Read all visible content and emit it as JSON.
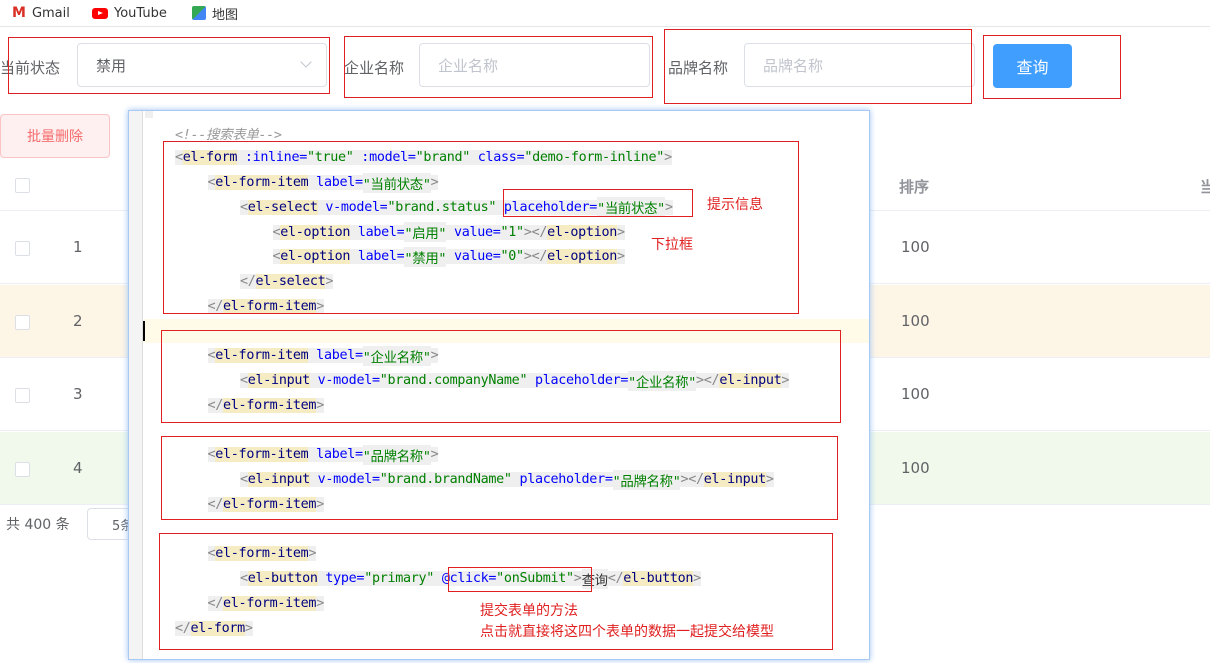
{
  "bookmarks": [
    {
      "label": "Gmail",
      "icon": "gmail-icon"
    },
    {
      "label": "YouTube",
      "icon": "youtube-icon"
    },
    {
      "label": "地图",
      "icon": "maps-icon"
    }
  ],
  "form": {
    "status_label": "当前状态",
    "status_value": "禁用",
    "company_label": "企业名称",
    "company_placeholder": "企业名称",
    "brand_label": "品牌名称",
    "brand_placeholder": "品牌名称",
    "query_button": "查询"
  },
  "batch_delete": "批量删除",
  "table": {
    "headers": {
      "sort": "排序",
      "status_partial": "当"
    },
    "rows": [
      {
        "index": "1",
        "sort": "100",
        "highlight": "none"
      },
      {
        "index": "2",
        "sort": "100",
        "highlight": "warning"
      },
      {
        "index": "3",
        "sort": "100",
        "highlight": "none"
      },
      {
        "index": "4",
        "sort": "100",
        "highlight": "success"
      }
    ]
  },
  "pagination": {
    "total": "共 400 条",
    "page_size_partial": "5条"
  },
  "colors": {
    "primary": "#409eff",
    "danger": "#f56c6c",
    "warning_row": "#fdf5e6",
    "success_row": "#f0f9eb",
    "annotation": "#e02020"
  },
  "code_lines": [
    {
      "indent": 0,
      "tokens": [
        {
          "t": "<!--搜索表单-->",
          "c": "cmt"
        }
      ]
    },
    {
      "indent": 0,
      "tokens": [
        {
          "t": "<",
          "c": "br"
        },
        {
          "t": "el-form",
          "c": "tag"
        },
        {
          "t": " :inline=",
          "c": "attr"
        },
        {
          "t": "\"true\"",
          "c": "str"
        },
        {
          "t": " :model=",
          "c": "attr"
        },
        {
          "t": "\"brand\"",
          "c": "str"
        },
        {
          "t": " class=",
          "c": "attr"
        },
        {
          "t": "\"demo-form-inline\"",
          "c": "str"
        },
        {
          "t": ">",
          "c": "br"
        }
      ]
    },
    {
      "indent": 1,
      "tokens": [
        {
          "t": "<",
          "c": "br"
        },
        {
          "t": "el-form-item",
          "c": "tag"
        },
        {
          "t": " label=",
          "c": "attr"
        },
        {
          "t": "\"当前状态\"",
          "c": "str"
        },
        {
          "t": ">",
          "c": "br"
        }
      ]
    },
    {
      "indent": 2,
      "tokens": [
        {
          "t": "<",
          "c": "br"
        },
        {
          "t": "el-select",
          "c": "tag"
        },
        {
          "t": " v-model=",
          "c": "attr"
        },
        {
          "t": "\"brand.status\"",
          "c": "str"
        },
        {
          "t": " placeholder=",
          "c": "attr"
        },
        {
          "t": "\"当前状态\"",
          "c": "str"
        },
        {
          "t": ">",
          "c": "br"
        }
      ]
    },
    {
      "indent": 3,
      "tokens": [
        {
          "t": "<",
          "c": "br"
        },
        {
          "t": "el-option",
          "c": "tag"
        },
        {
          "t": " label=",
          "c": "attr"
        },
        {
          "t": "\"启用\"",
          "c": "str"
        },
        {
          "t": " value=",
          "c": "attr"
        },
        {
          "t": "\"1\"",
          "c": "str"
        },
        {
          "t": "></",
          "c": "br"
        },
        {
          "t": "el-option",
          "c": "tagc"
        },
        {
          "t": ">",
          "c": "br"
        }
      ]
    },
    {
      "indent": 3,
      "tokens": [
        {
          "t": "<",
          "c": "br"
        },
        {
          "t": "el-option",
          "c": "tag"
        },
        {
          "t": " label=",
          "c": "attr"
        },
        {
          "t": "\"禁用\"",
          "c": "str"
        },
        {
          "t": " value=",
          "c": "attr"
        },
        {
          "t": "\"0\"",
          "c": "str"
        },
        {
          "t": "></",
          "c": "br"
        },
        {
          "t": "el-option",
          "c": "tagc"
        },
        {
          "t": ">",
          "c": "br"
        }
      ]
    },
    {
      "indent": 2,
      "tokens": [
        {
          "t": "</",
          "c": "br"
        },
        {
          "t": "el-select",
          "c": "tagc"
        },
        {
          "t": ">",
          "c": "br"
        }
      ]
    },
    {
      "indent": 1,
      "tokens": [
        {
          "t": "</",
          "c": "br"
        },
        {
          "t": "el-form-item",
          "c": "tagc"
        },
        {
          "t": ">",
          "c": "br"
        }
      ]
    },
    {
      "indent": 0,
      "tokens": []
    },
    {
      "indent": 1,
      "tokens": [
        {
          "t": "<",
          "c": "br"
        },
        {
          "t": "el-form-item",
          "c": "tag"
        },
        {
          "t": " label=",
          "c": "attr"
        },
        {
          "t": "\"企业名称\"",
          "c": "str"
        },
        {
          "t": ">",
          "c": "br"
        }
      ]
    },
    {
      "indent": 2,
      "tokens": [
        {
          "t": "<",
          "c": "br"
        },
        {
          "t": "el-input",
          "c": "tag"
        },
        {
          "t": " v-model=",
          "c": "attr"
        },
        {
          "t": "\"brand.companyName\"",
          "c": "str"
        },
        {
          "t": " placeholder=",
          "c": "attr"
        },
        {
          "t": "\"企业名称\"",
          "c": "str"
        },
        {
          "t": "></",
          "c": "br"
        },
        {
          "t": "el-input",
          "c": "tagc"
        },
        {
          "t": ">",
          "c": "br"
        }
      ]
    },
    {
      "indent": 1,
      "tokens": [
        {
          "t": "</",
          "c": "br"
        },
        {
          "t": "el-form-item",
          "c": "tagc"
        },
        {
          "t": ">",
          "c": "br"
        }
      ]
    },
    {
      "indent": 0,
      "tokens": []
    },
    {
      "indent": 1,
      "tokens": [
        {
          "t": "<",
          "c": "br"
        },
        {
          "t": "el-form-item",
          "c": "tag"
        },
        {
          "t": " label=",
          "c": "attr"
        },
        {
          "t": "\"品牌名称\"",
          "c": "str"
        },
        {
          "t": ">",
          "c": "br"
        }
      ]
    },
    {
      "indent": 2,
      "tokens": [
        {
          "t": "<",
          "c": "br"
        },
        {
          "t": "el-input",
          "c": "tag"
        },
        {
          "t": " v-model=",
          "c": "attr"
        },
        {
          "t": "\"brand.brandName\"",
          "c": "str"
        },
        {
          "t": " placeholder=",
          "c": "attr"
        },
        {
          "t": "\"品牌名称\"",
          "c": "str"
        },
        {
          "t": "></",
          "c": "br"
        },
        {
          "t": "el-input",
          "c": "tagc"
        },
        {
          "t": ">",
          "c": "br"
        }
      ]
    },
    {
      "indent": 1,
      "tokens": [
        {
          "t": "</",
          "c": "br"
        },
        {
          "t": "el-form-item",
          "c": "tagc"
        },
        {
          "t": ">",
          "c": "br"
        }
      ]
    },
    {
      "indent": 0,
      "tokens": []
    },
    {
      "indent": 1,
      "tokens": [
        {
          "t": "<",
          "c": "br"
        },
        {
          "t": "el-form-item",
          "c": "tag"
        },
        {
          "t": ">",
          "c": "br"
        }
      ]
    },
    {
      "indent": 2,
      "tokens": [
        {
          "t": "<",
          "c": "br"
        },
        {
          "t": "el-button",
          "c": "tag"
        },
        {
          "t": " type=",
          "c": "attr"
        },
        {
          "t": "\"primary\"",
          "c": "str"
        },
        {
          "t": " @click=",
          "c": "attr"
        },
        {
          "t": "\"onSubmit\"",
          "c": "str"
        },
        {
          "t": ">",
          "c": "br"
        },
        {
          "t": "查询",
          "c": "txt"
        },
        {
          "t": "</",
          "c": "br"
        },
        {
          "t": "el-button",
          "c": "tagc"
        },
        {
          "t": ">",
          "c": "br"
        }
      ]
    },
    {
      "indent": 1,
      "tokens": [
        {
          "t": "</",
          "c": "br"
        },
        {
          "t": "el-form-item",
          "c": "tagc"
        },
        {
          "t": ">",
          "c": "br"
        }
      ]
    },
    {
      "indent": 0,
      "tokens": [
        {
          "t": "</",
          "c": "br"
        },
        {
          "t": "el-form",
          "c": "tagc"
        },
        {
          "t": ">",
          "c": "br"
        }
      ]
    }
  ],
  "annotations": {
    "hint": "提示信息",
    "dropdown": "下拉框",
    "submit_line1": "提交表单的方法",
    "submit_line2": "点击就直接将这四个表单的数据一起提交给模型"
  }
}
